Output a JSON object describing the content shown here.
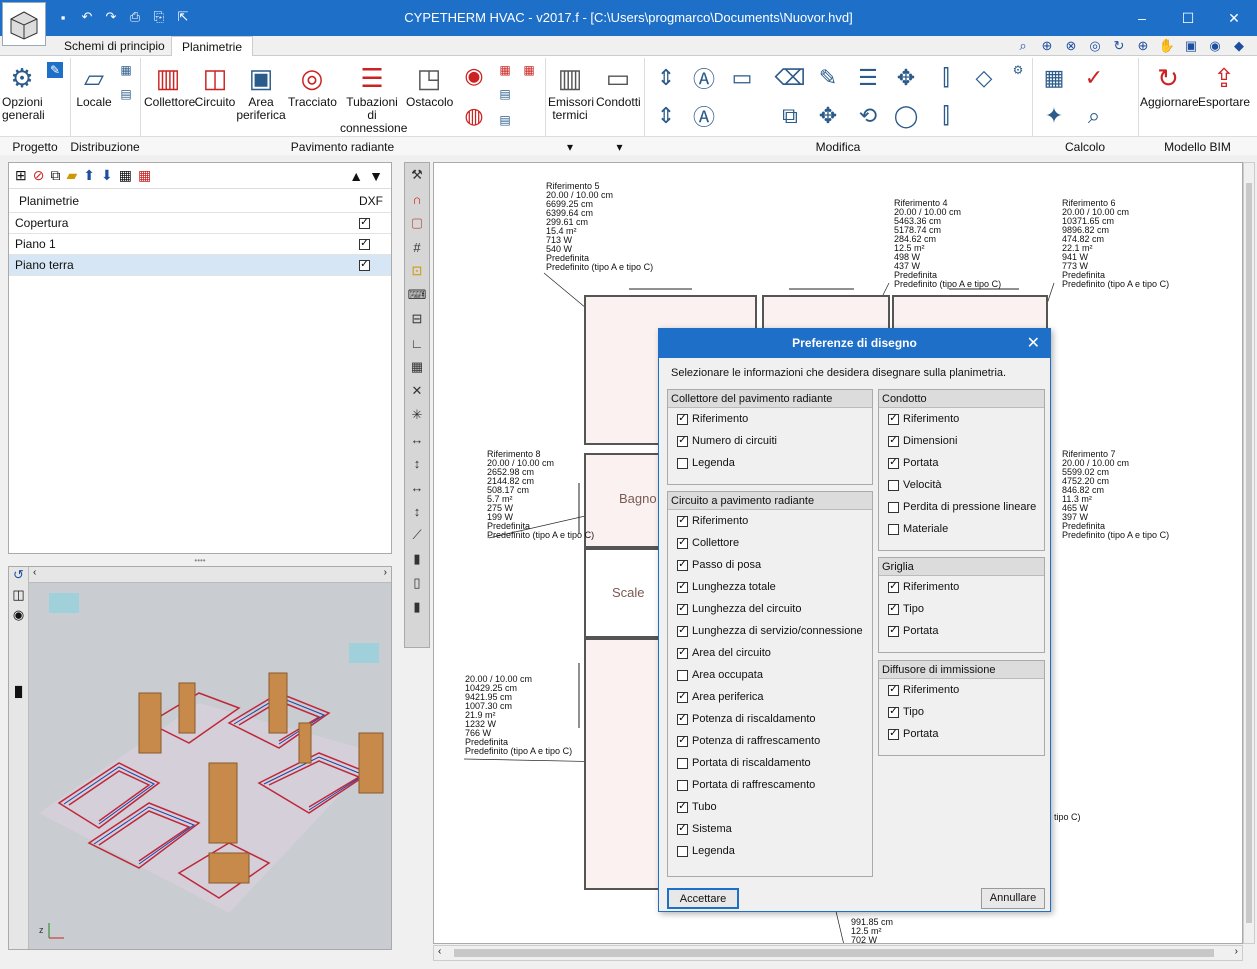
{
  "window": {
    "title": "CYPETHERM HVAC - v2017.f - [C:\\Users\\progmarco\\Documents\\Nuovor.hvd]"
  },
  "tabs": [
    "Schemi di principio",
    "Planimetrie"
  ],
  "ribbon": {
    "buttons": {
      "opzioni": "Opzioni generali",
      "locale": "Locale",
      "collettore": "Collettore",
      "circuito": "Circuito",
      "area": "Area periferica",
      "tracciato": "Tracciato",
      "tubazioni": "Tubazioni di connessione",
      "ostacolo": "Ostacolo",
      "emissori": "Emissori termici",
      "condotti": "Condotti",
      "aggiornare": "Aggiornare",
      "esportare": "Esportare"
    },
    "groups": [
      "Progetto",
      "Distribuzione",
      "Pavimento radiante",
      "Modifica",
      "Calcolo",
      "Modello BIM"
    ]
  },
  "planimetrie": {
    "header": "Planimetrie",
    "dxf_header": "DXF",
    "rows": [
      {
        "name": "Copertura",
        "dxf": true
      },
      {
        "name": "Piano 1",
        "dxf": true
      },
      {
        "name": "Piano terra",
        "dxf": true
      }
    ]
  },
  "canvas": {
    "annotations": [
      "Riferimento 5\n20.00 / 10.00 cm\n6699.25 cm\n6399.64 cm\n299.61 cm\n15.4 m²\n713 W\n540 W\nPredefinita\nPredefinito (tipo A e tipo C)",
      "Riferimento 4\n20.00 / 10.00 cm\n5463.36 cm\n5178.74 cm\n284.62 cm\n12.5 m²\n498 W\n437 W\nPredefinita\nPredefinito (tipo A e tipo C)",
      "Riferimento 6\n20.00 / 10.00 cm\n10371.65 cm\n9896.82 cm\n474.82 cm\n22.1 m²\n941 W\n773 W\nPredefinita\nPredefinito (tipo A e tipo C)",
      "Riferimento 8\n20.00 / 10.00 cm\n2652.98 cm\n2144.82 cm\n508.17 cm\n5.7 m²\n275 W\n199 W\nPredefinita\nPredefinito (tipo A e tipo C)",
      "Riferimento 7\n20.00 / 10.00 cm\n5599.02 cm\n4752.20 cm\n846.82 cm\n11.3 m²\n465 W\n397 W\nPredefinita\nPredefinito (tipo A e tipo C)",
      "20.00 / 10.00 cm\n10429.25 cm\n9421.95 cm\n1007.30 cm\n21.9 m²\n1232 W\n766 W\nPredefinita\nPredefinito (tipo A e tipo C)",
      "991.85 cm\n12.5 m²\n702 W"
    ],
    "partial_annotation": "tipo C)",
    "rooms": [
      "Bagno",
      "Scale"
    ]
  },
  "dialog": {
    "title": "Preferenze di disegno",
    "info": "Selezionare le informazioni che desidera disegnare sulla planimetria.",
    "groups": [
      {
        "title": "Collettore del pavimento radiante",
        "options": [
          {
            "label": "Riferimento",
            "checked": true
          },
          {
            "label": "Numero di circuiti",
            "checked": true
          },
          {
            "label": "Legenda",
            "checked": false
          }
        ]
      },
      {
        "title": "Circuito a pavimento radiante",
        "options": [
          {
            "label": "Riferimento",
            "checked": true
          },
          {
            "label": "Collettore",
            "checked": true
          },
          {
            "label": "Passo di posa",
            "checked": true
          },
          {
            "label": "Lunghezza totale",
            "checked": true
          },
          {
            "label": "Lunghezza del circuito",
            "checked": true
          },
          {
            "label": "Lunghezza di servizio/connessione",
            "checked": true
          },
          {
            "label": "Area del circuito",
            "checked": true
          },
          {
            "label": "Area occupata",
            "checked": false
          },
          {
            "label": "Area periferica",
            "checked": true
          },
          {
            "label": "Potenza di riscaldamento",
            "checked": true
          },
          {
            "label": "Potenza di raffrescamento",
            "checked": true
          },
          {
            "label": "Portata di riscaldamento",
            "checked": false
          },
          {
            "label": "Portata di raffrescamento",
            "checked": false
          },
          {
            "label": "Tubo",
            "checked": true
          },
          {
            "label": "Sistema",
            "checked": true
          },
          {
            "label": "Legenda",
            "checked": false
          }
        ]
      },
      {
        "title": "Condotto",
        "options": [
          {
            "label": "Riferimento",
            "checked": true
          },
          {
            "label": "Dimensioni",
            "checked": true
          },
          {
            "label": "Portata",
            "checked": true
          },
          {
            "label": "Velocità",
            "checked": false
          },
          {
            "label": "Perdita di pressione lineare",
            "checked": false
          },
          {
            "label": "Materiale",
            "checked": false
          }
        ]
      },
      {
        "title": "Griglia",
        "options": [
          {
            "label": "Riferimento",
            "checked": true
          },
          {
            "label": "Tipo",
            "checked": true
          },
          {
            "label": "Portata",
            "checked": true
          }
        ]
      },
      {
        "title": "Diffusore di immissione",
        "options": [
          {
            "label": "Riferimento",
            "checked": true
          },
          {
            "label": "Tipo",
            "checked": true
          },
          {
            "label": "Portata",
            "checked": true
          }
        ]
      }
    ],
    "ok": "Accettare",
    "cancel": "Annullare"
  }
}
